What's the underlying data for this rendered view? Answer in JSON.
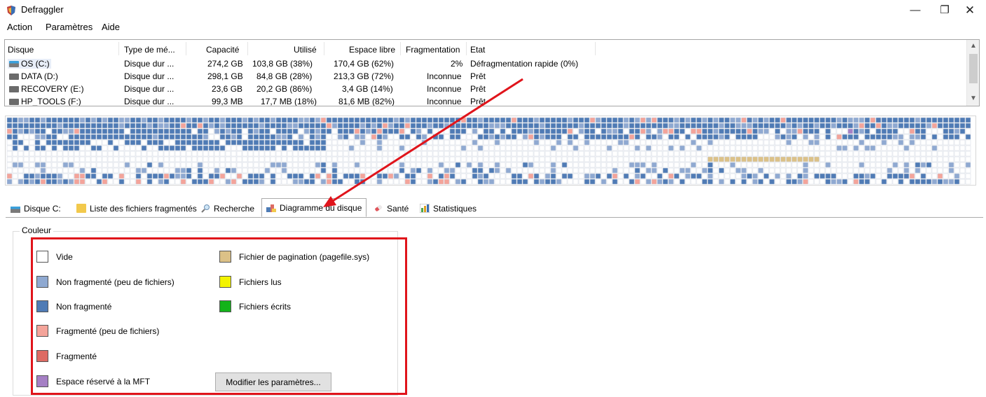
{
  "window": {
    "title": "Defraggler",
    "minimize": "—",
    "maximize": "❐",
    "close": "✕"
  },
  "menu": [
    "Action",
    "Paramètres",
    "Aide"
  ],
  "drives": {
    "columns": [
      "Disque",
      "Type de mé...",
      "Capacité",
      "Utilisé",
      "Espace libre",
      "Fragmentation",
      "Etat"
    ],
    "rows": [
      {
        "name": "OS (C:)",
        "type": "Disque dur ...",
        "capacity": "274,2 GB",
        "used": "103,8 GB (38%)",
        "free": "170,4 GB (62%)",
        "frag": "2%",
        "state": "Défragmentation rapide (0%)",
        "icon": "system-drive-icon"
      },
      {
        "name": "DATA (D:)",
        "type": "Disque dur ...",
        "capacity": "298,1 GB",
        "used": "84,8 GB (28%)",
        "free": "213,3 GB (72%)",
        "frag": "Inconnue",
        "state": "Prêt",
        "icon": "drive-icon"
      },
      {
        "name": "RECOVERY (E:)",
        "type": "Disque dur ...",
        "capacity": "23,6 GB",
        "used": "20,2 GB (86%)",
        "free": "3,4 GB (14%)",
        "frag": "Inconnue",
        "state": "Prêt",
        "icon": "drive-icon"
      },
      {
        "name": "HP_TOOLS (F:)",
        "type": "Disque dur ...",
        "capacity": "99,3 MB",
        "used": "17,7 MB (18%)",
        "free": "81,6 MB (82%)",
        "frag": "Inconnue",
        "state": "Prêt",
        "icon": "drive-icon"
      }
    ]
  },
  "tabs": [
    {
      "label": "Disque C:",
      "icon": "drive-icon",
      "active": false
    },
    {
      "label": "Liste des fichiers fragmentés",
      "icon": "folder-icon",
      "active": false
    },
    {
      "label": "Recherche",
      "icon": "search-icon",
      "active": false
    },
    {
      "label": "Diagramme du disque",
      "icon": "disk-map-icon",
      "active": true
    },
    {
      "label": "Santé",
      "icon": "health-icon",
      "active": false
    },
    {
      "label": "Statistiques",
      "icon": "statistics-icon",
      "active": false
    }
  ],
  "legend": {
    "group_title": "Couleur",
    "items": [
      {
        "label": "Vide",
        "color": "#ffffff"
      },
      {
        "label": "Non fragmenté (peu de fichiers)",
        "color": "#8fa9d1"
      },
      {
        "label": "Non fragmenté",
        "color": "#4f7bb5"
      },
      {
        "label": "Fragmenté (peu de fichiers)",
        "color": "#f4a49a"
      },
      {
        "label": "Fragmenté",
        "color": "#dd6b63"
      },
      {
        "label": "Espace réservé à la MFT",
        "color": "#a57fc4"
      },
      {
        "label": "Fichier de pagination (pagefile.sys)",
        "color": "#dcc187"
      },
      {
        "label": "Fichiers lus",
        "color": "#f3f300"
      },
      {
        "label": "Fichiers écrits",
        "color": "#13b31a"
      }
    ],
    "button_label": "Modifier les paramètres..."
  },
  "colors": {
    "accent_annotation": "#e0141b",
    "block_empty": "#ffffff",
    "block_used_light": "#8fa9d1",
    "block_used": "#4f7bb5",
    "block_frag_light": "#f4a49a",
    "block_frag": "#dd6b63",
    "block_mft": "#a57fc4",
    "block_pagefile": "#dcc187"
  }
}
